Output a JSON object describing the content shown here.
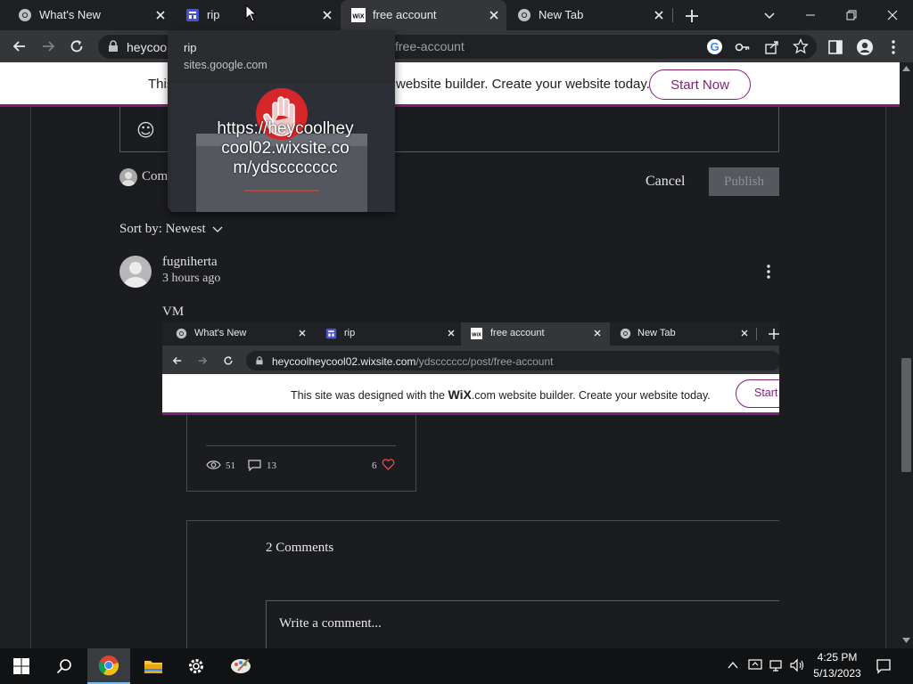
{
  "browser": {
    "tabs": [
      {
        "title": "What's New",
        "active": false
      },
      {
        "title": "rip",
        "active": false
      },
      {
        "title": "free account",
        "active": true
      },
      {
        "title": "New Tab",
        "active": false
      }
    ],
    "url_visible": "heycoo",
    "url_tail": "free-account"
  },
  "hovercard": {
    "title": "rip",
    "domain": "sites.google.com",
    "preview_text": "https://heycoolheycool02.wixsite.com/ydsccccccc"
  },
  "banner": {
    "text_before": "This",
    "text_after": "website builder. Create your website today.",
    "start_label": "Start Now"
  },
  "comment_editor": {
    "smiley": "☺",
    "commenting_as": "Com",
    "cancel_label": "Cancel",
    "publish_label": "Publish"
  },
  "sort": {
    "label": "Sort by: Newest"
  },
  "comment": {
    "author": "fugniherta",
    "time": "3 hours ago",
    "body": "VM"
  },
  "screenshot": {
    "tabs": [
      {
        "title": "What's New"
      },
      {
        "title": "rip"
      },
      {
        "title": "free account"
      },
      {
        "title": "New Tab"
      }
    ],
    "url_host": "heycoolheycool02.wixsite.com",
    "url_path": "/ydscccccc/post/free-account",
    "banner_before": "This site was designed with the",
    "banner_wix": "WiX",
    "banner_after": ".com website builder. Create your website today.",
    "banner_start": "Start",
    "views": "51",
    "comments": "13",
    "likes": "6",
    "comments_title": "2 Comments",
    "write_placeholder": "Write a comment..."
  },
  "taskbar": {
    "time": "4:25 PM",
    "date": "5/13/2023"
  },
  "colors": {
    "accent": "#7e1e78",
    "chrome_dark": "#35363a",
    "page_bg": "#1e1f22"
  }
}
